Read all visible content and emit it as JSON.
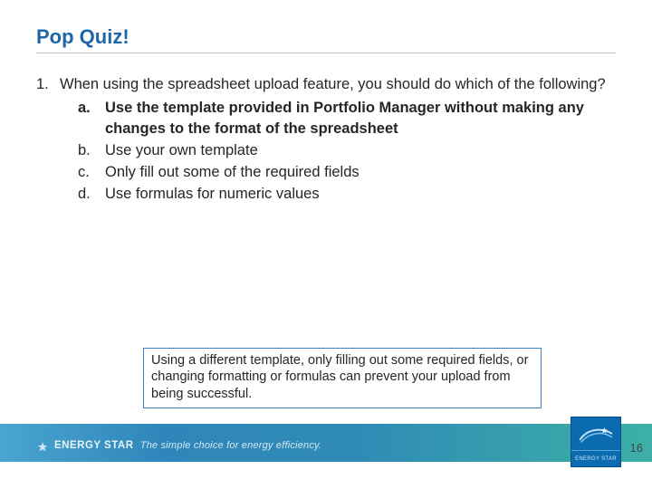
{
  "title": "Pop Quiz!",
  "question": {
    "number": "1.",
    "text": "When using the spreadsheet upload feature, you should do which of the following?",
    "options": [
      {
        "letter": "a.",
        "text": "Use the template provided in Portfolio Manager without making any changes to the format of the spreadsheet",
        "bold": true
      },
      {
        "letter": "b.",
        "text": "Use your own template",
        "bold": false
      },
      {
        "letter": "c.",
        "text": "Only fill out some of the required fields",
        "bold": false
      },
      {
        "letter": "d.",
        "text": "Use formulas for numeric values",
        "bold": false
      }
    ]
  },
  "note": "Using a different template, only filling out some required fields, or changing formatting or formulas can prevent your upload from being successful.",
  "footer": {
    "brand": "ENERGY STAR",
    "tagline": "The simple choice for energy efficiency.",
    "logo_label": "ENERGY STAR"
  },
  "page_number": "16"
}
